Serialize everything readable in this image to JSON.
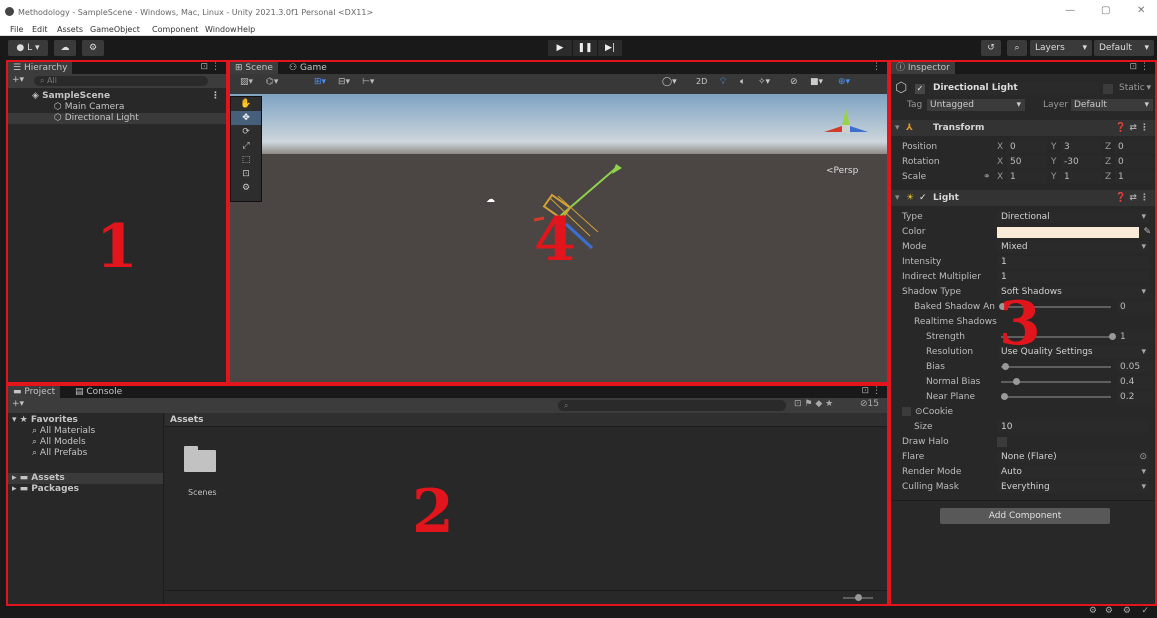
{
  "window": {
    "title": "Methodology - SampleScene - Windows, Mac, Linux - Unity 2021.3.0f1 Personal <DX11>",
    "controls": [
      "—",
      "▢",
      "✕"
    ]
  },
  "menu": [
    "File",
    "Edit",
    "Assets",
    "GameObject",
    "Component",
    "Window",
    "Help"
  ],
  "toolbar": {
    "account": "L ▾",
    "layers": "Layers",
    "layout": "Default",
    "play": "▶",
    "pause": "❚❚",
    "step": "▶|"
  },
  "hierarchy": {
    "tab": "Hierarchy",
    "search_placeholder": "All",
    "scene": "SampleScene",
    "items": [
      "Main Camera",
      "Directional Light"
    ],
    "number": "1"
  },
  "scene_view": {
    "tabs": [
      "Scene",
      "Game"
    ],
    "mode_2d": "2D",
    "persp_label": "<Persp",
    "number": "4"
  },
  "project": {
    "tabs": [
      "Project",
      "Console"
    ],
    "favorites": "Favorites",
    "favorite_items": [
      "All Materials",
      "All Models",
      "All Prefabs"
    ],
    "roots": [
      "Assets",
      "Packages"
    ],
    "breadcrumb": "Assets",
    "folder": "Scenes",
    "hidden_count": "15",
    "number": "2"
  },
  "inspector": {
    "tab": "Inspector",
    "object_name": "Directional Light",
    "static_label": "Static",
    "tag_label": "Tag",
    "tag_value": "Untagged",
    "layer_label": "Layer",
    "layer_value": "Default",
    "transform": {
      "title": "Transform",
      "position": {
        "label": "Position",
        "x": "0",
        "y": "3",
        "z": "0"
      },
      "rotation": {
        "label": "Rotation",
        "x": "50",
        "y": "-30",
        "z": "0"
      },
      "scale": {
        "label": "Scale",
        "x": "1",
        "y": "1",
        "z": "1"
      }
    },
    "light": {
      "title": "Light",
      "type": {
        "label": "Type",
        "value": "Directional"
      },
      "color": {
        "label": "Color",
        "value": "#f8ecd8"
      },
      "mode": {
        "label": "Mode",
        "value": "Mixed"
      },
      "intensity": {
        "label": "Intensity",
        "value": "1"
      },
      "indirect": {
        "label": "Indirect Multiplier",
        "value": "1"
      },
      "shadow_type": {
        "label": "Shadow Type",
        "value": "Soft Shadows"
      },
      "baked_angle": {
        "label": "Baked Shadow An",
        "value": "0",
        "level": 0
      },
      "realtime": "Realtime Shadows",
      "strength": {
        "label": "Strength",
        "value": "1",
        "level": 1
      },
      "resolution": {
        "label": "Resolution",
        "value": "Use Quality Settings"
      },
      "bias": {
        "label": "Bias",
        "value": "0.05",
        "level": 0.025
      },
      "normal_bias": {
        "label": "Normal Bias",
        "value": "0.4",
        "level": 0.13
      },
      "near_plane": {
        "label": "Near Plane",
        "value": "0.2",
        "level": 0.02
      },
      "cookie": {
        "label": "Cookie"
      },
      "size": {
        "label": "Size",
        "value": "10"
      },
      "draw_halo": {
        "label": "Draw Halo"
      },
      "flare": {
        "label": "Flare",
        "value": "None (Flare)"
      },
      "render_mode": {
        "label": "Render Mode",
        "value": "Auto"
      },
      "culling_mask": {
        "label": "Culling Mask",
        "value": "Everything"
      }
    },
    "add_component": "Add Component",
    "number": "3"
  },
  "colors": {
    "annotation_red": "#e1151b",
    "panel_bg": "#282828",
    "selection_blue": "#2c5d87"
  }
}
